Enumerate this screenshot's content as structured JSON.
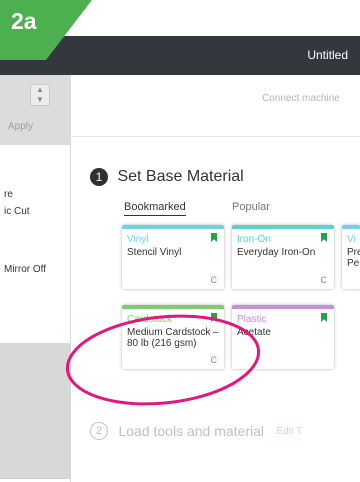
{
  "badge": {
    "label": "2a"
  },
  "header": {
    "document_title": "Untitled"
  },
  "left_panel": {
    "apply_label": "Apply",
    "texts": [
      "re",
      "ic Cut",
      "Mirror Off"
    ]
  },
  "main": {
    "connect_label": "Connect machine",
    "step1": {
      "number": "1",
      "title": "Set Base Material"
    },
    "tabs": [
      {
        "label": "Bookmarked",
        "active": true
      },
      {
        "label": "Popular",
        "active": false
      }
    ],
    "cards": [
      {
        "category": "Vinyl",
        "name": "Stencil Vinyl",
        "color": "#6fd0e6",
        "cut": "C"
      },
      {
        "category": "Iron-On",
        "name": "Everyday Iron-On",
        "color": "#5ccfcf",
        "cut": "C"
      },
      {
        "category": "Vi",
        "name": "Pre Pe",
        "color": "#6fd0e6",
        "cut": ""
      },
      {
        "category": "Cardstock",
        "name": "Medium Cardstock – 80 lb (216 gsm)",
        "color": "#7ccd6e",
        "cut": "C"
      },
      {
        "category": "Plastic",
        "name": "Acetate",
        "color": "#c98de0",
        "cut": ""
      }
    ],
    "step2": {
      "number": "2",
      "title": "Load tools and material",
      "edit_label": "Edit T"
    }
  },
  "colors": {
    "badge_green": "#4caf50",
    "header_dark": "#33383f",
    "bookmark_green": "#2a9d4a",
    "annotation_pink": "#e0177f"
  },
  "icons": [
    "stepper-icon",
    "bookmark-icon",
    "cut-icon"
  ]
}
